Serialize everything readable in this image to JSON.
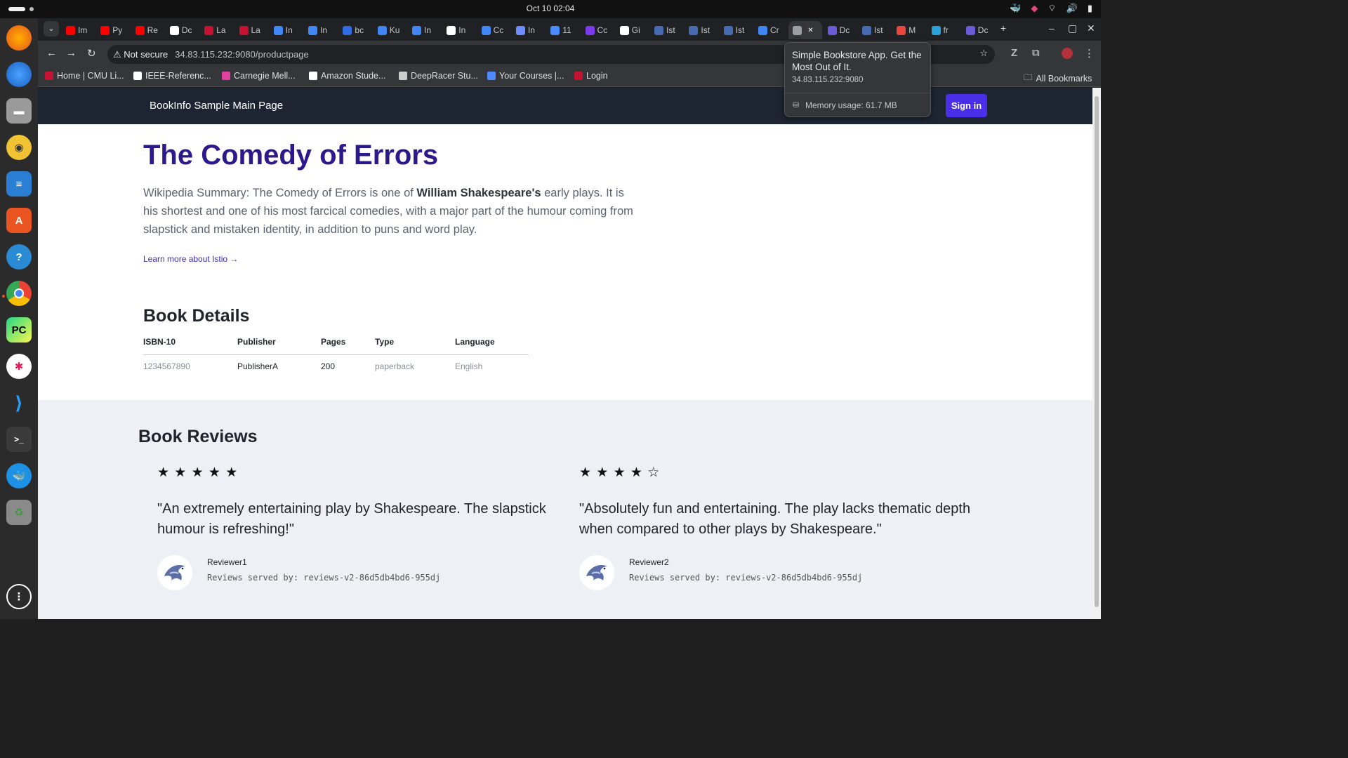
{
  "system": {
    "clock": "Oct 10  02:04"
  },
  "browser": {
    "tabs": [
      {
        "label": "Im",
        "color": "#ff0000"
      },
      {
        "label": "Py",
        "color": "#ff0000"
      },
      {
        "label": "Re",
        "color": "#ff0000"
      },
      {
        "label": "Dc",
        "color": "#ffffff"
      },
      {
        "label": "La",
        "color": "#c41230"
      },
      {
        "label": "La",
        "color": "#c41230"
      },
      {
        "label": "In",
        "color": "#4285f4"
      },
      {
        "label": "In",
        "color": "#4285f4"
      },
      {
        "label": "bc",
        "color": "#326ce5"
      },
      {
        "label": "Ku",
        "color": "#4285f4"
      },
      {
        "label": "In",
        "color": "#4285f4"
      },
      {
        "label": "In",
        "color": "#ffffff"
      },
      {
        "label": "Cc",
        "color": "#4285f4"
      },
      {
        "label": "In",
        "color": "#6c8cff"
      },
      {
        "label": "11",
        "color": "#4a8cff"
      },
      {
        "label": "Cc",
        "color": "#7c3aed"
      },
      {
        "label": "Gi",
        "color": "#ffffff"
      },
      {
        "label": "Ist",
        "color": "#466bb0"
      },
      {
        "label": "Ist",
        "color": "#466bb0"
      },
      {
        "label": "Ist",
        "color": "#466bb0"
      },
      {
        "label": "Cr",
        "color": "#4285f4"
      },
      {
        "label": "",
        "color": "#9aa0a6"
      },
      {
        "label": "Dc",
        "color": "#6b5bd6"
      },
      {
        "label": "Ist",
        "color": "#466bb0"
      },
      {
        "label": "M",
        "color": "#e8453c"
      },
      {
        "label": "fr",
        "color": "#2aa4d8"
      },
      {
        "label": "Dc",
        "color": "#6b5bd6"
      }
    ],
    "not_secure_label": "Not secure",
    "url": "34.83.115.232:9080/productpage",
    "bookmarks": [
      {
        "label": "Home | CMU Li...",
        "color": "#c41230"
      },
      {
        "label": "IEEE-Referenc...",
        "color": "#ffffff"
      },
      {
        "label": "Carnegie Mell...",
        "color": "#e040a0"
      },
      {
        "label": "Amazon Stude...",
        "color": "#ffffff"
      },
      {
        "label": "DeepRacer Stu...",
        "color": "#cccccc"
      },
      {
        "label": "Your Courses |...",
        "color": "#4a8cff"
      },
      {
        "label": "Login",
        "color": "#c41230"
      }
    ],
    "all_bookmarks": "All Bookmarks",
    "tooltip": {
      "title": "Simple Bookstore App. Get the Most Out of It.",
      "url": "34.83.115.232:9080",
      "memory": "Memory usage: 61.7 MB"
    }
  },
  "page": {
    "brand": "BookInfo Sample Main Page",
    "sign_in": "Sign in",
    "title": "The Comedy of Errors",
    "summary_prefix": "Wikipedia Summary: The Comedy of Errors is one of ",
    "summary_bold": "William Shakespeare's",
    "summary_suffix": " early plays. It is his shortest and one of his most farcical comedies, with a major part of the humour coming from slapstick and mistaken identity, in addition to puns and word play.",
    "learn_more": "Learn more about Istio →",
    "details": {
      "title": "Book Details",
      "headers": [
        "ISBN-10",
        "Publisher",
        "Pages",
        "Type",
        "Language"
      ],
      "values": [
        "1234567890",
        "PublisherA",
        "200",
        "paperback",
        "English"
      ]
    },
    "reviews": {
      "title": "Book Reviews",
      "items": [
        {
          "stars": 5,
          "stars_text": "★ ★ ★ ★ ★",
          "text": "\"An extremely entertaining play by Shakespeare. The slapstick humour is refreshing!\"",
          "reviewer": "Reviewer1",
          "served_by": "Reviews served by: reviews-v2-86d5db4bd6-955dj"
        },
        {
          "stars": 4,
          "stars_text": "★ ★ ★ ★ ☆",
          "text": "\"Absolutely fun and entertaining. The play lacks thematic depth when compared to other plays by Shakespeare.\"",
          "reviewer": "Reviewer2",
          "served_by": "Reviews served by: reviews-v2-86d5db4bd6-955dj"
        }
      ]
    }
  }
}
